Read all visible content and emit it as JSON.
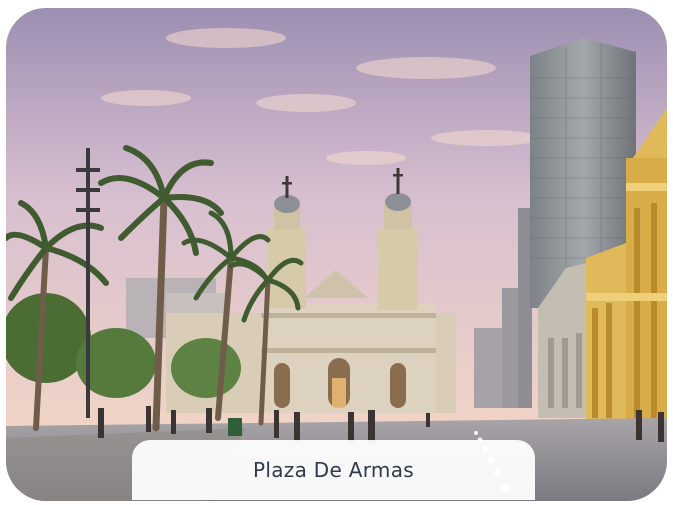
{
  "photo": {
    "subject": "cathedral-plaza-photo"
  },
  "caption": {
    "text": "Plaza De Armas"
  },
  "colors": {
    "sky_top": "#9d8fb2",
    "sky_bottom": "#f1d4c6",
    "cathedral": "#d9cdb8",
    "yellow_building": "#e0b95a",
    "glass_tower": "#8f949a",
    "palm": "#3f5b2f",
    "ground": "#8d8c92"
  }
}
